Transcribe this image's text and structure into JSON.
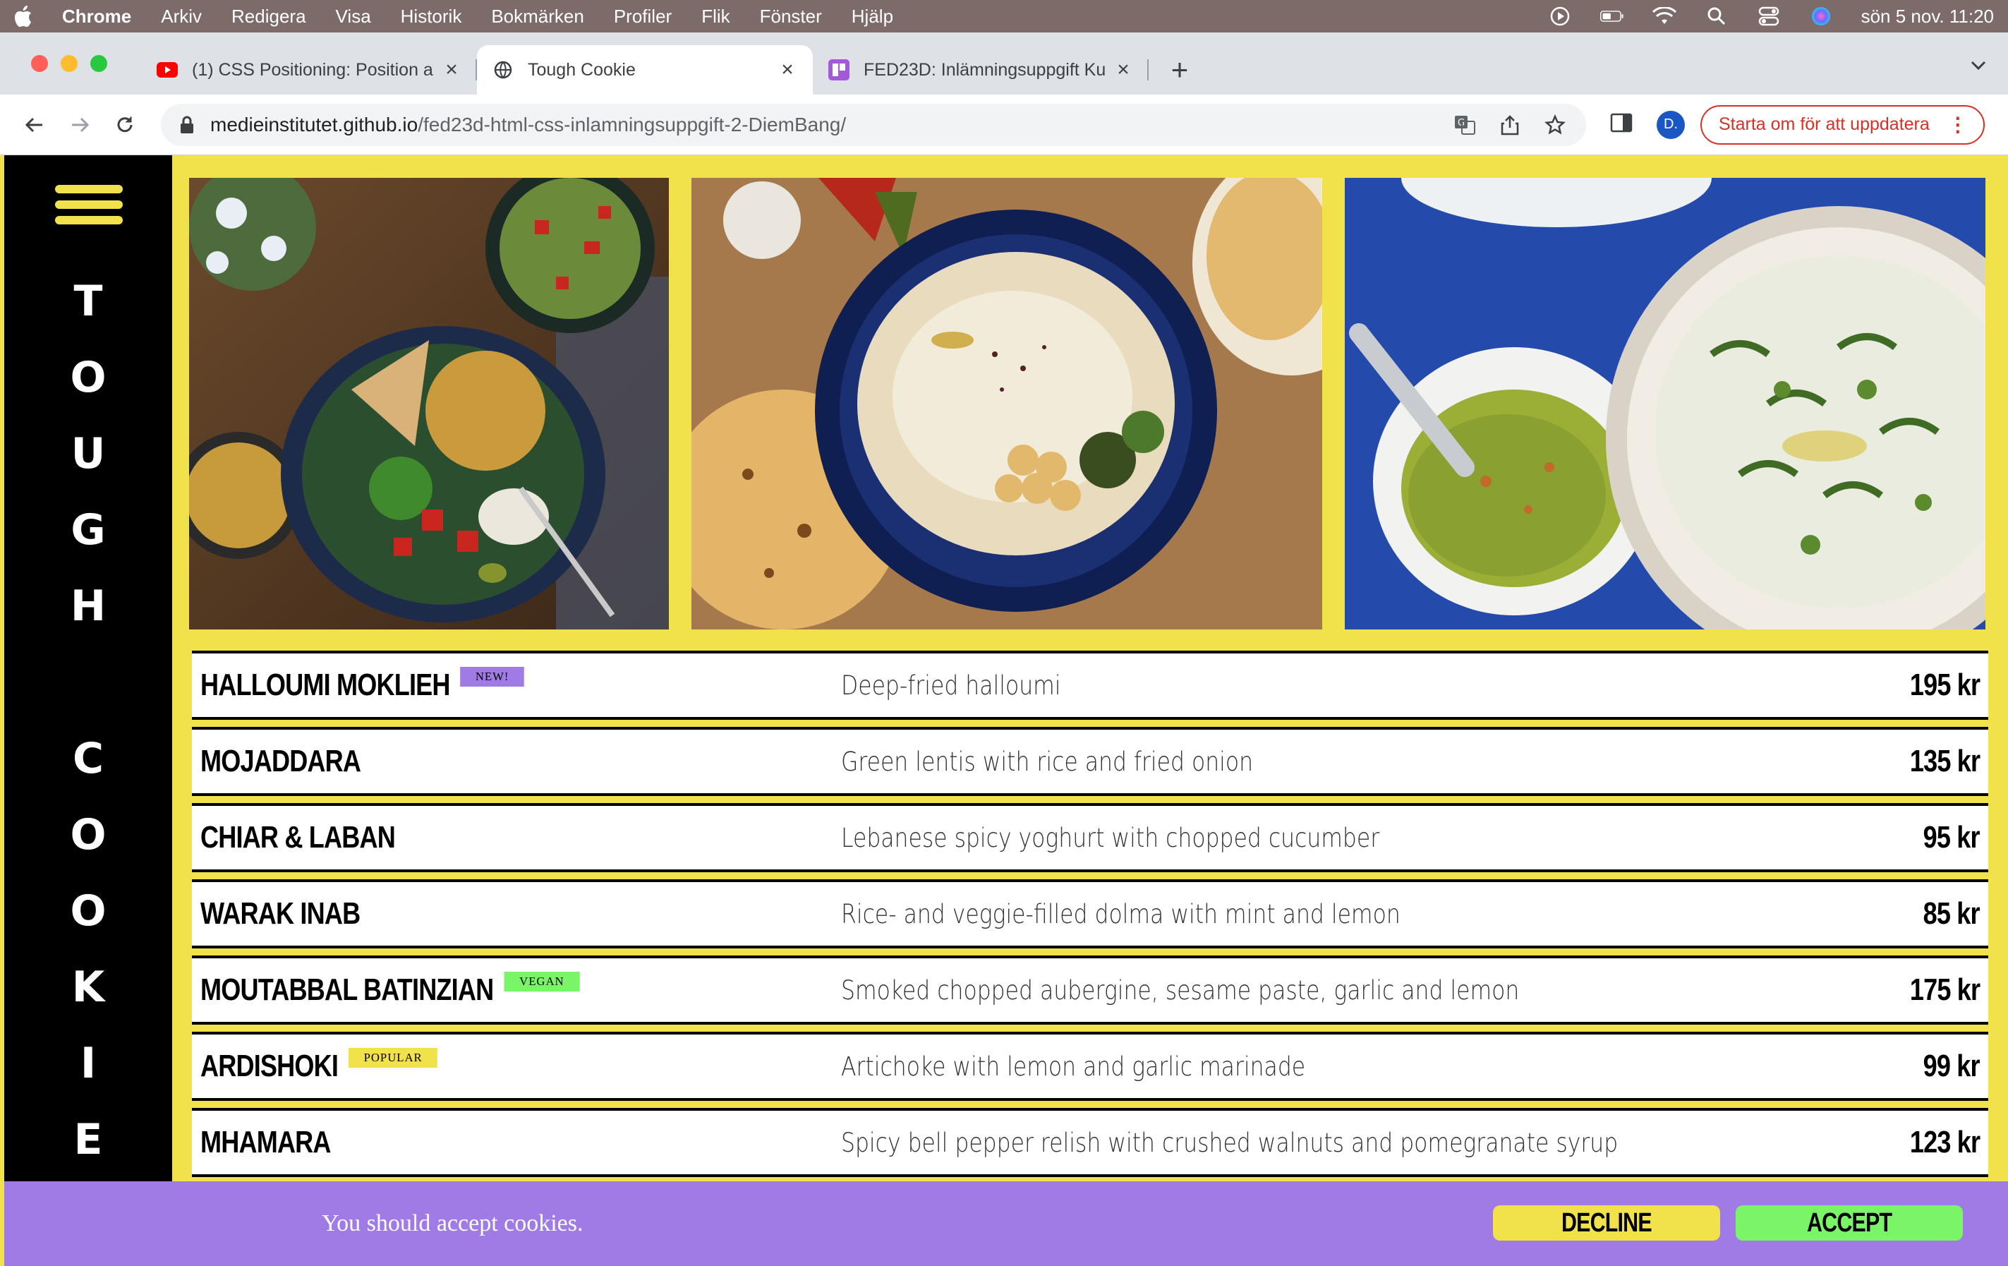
{
  "menubar": {
    "items": [
      "Chrome",
      "Arkiv",
      "Redigera",
      "Visa",
      "Historik",
      "Bokmärken",
      "Profiler",
      "Flik",
      "Fönster",
      "Hjälp"
    ],
    "clock": "sön 5 nov. 11:20"
  },
  "tabs": [
    {
      "title": "(1) CSS Positioning: Position a",
      "icon": "youtube-icon"
    },
    {
      "title": "Tough Cookie",
      "icon": "globe-icon"
    },
    {
      "title": "FED23D: Inlämningsuppgift Ku",
      "icon": "classroom-icon"
    }
  ],
  "address": {
    "host": "medieinstitutet.github.io",
    "path": "/fed23d-html-css-inlamningsuppgift-2-DiemBang/"
  },
  "profile_initial": "D.",
  "update_label": "Starta om för att uppdatera",
  "brand": {
    "word1": [
      "T",
      "O",
      "U",
      "G",
      "H"
    ],
    "word2": [
      "C",
      "O",
      "O",
      "K",
      "I",
      "E"
    ]
  },
  "photos": [
    {
      "alt": "mezze-bowl-photo"
    },
    {
      "alt": "hummus-photo"
    },
    {
      "alt": "yoghurt-dip-photo"
    }
  ],
  "menu": [
    {
      "name": "HALLOUMI MOKLIEH",
      "badge": "NEW!",
      "badge_color": "#a07be6",
      "desc": "Deep-fried halloumi",
      "price": "195 kr"
    },
    {
      "name": "MOJADDARA",
      "badge": "",
      "badge_color": "",
      "desc": "Green lentis with rice and fried onion",
      "price": "135 kr"
    },
    {
      "name": "CHIAR & LABAN",
      "badge": "",
      "badge_color": "",
      "desc": "Lebanese spicy yoghurt with chopped cucumber",
      "price": "95 kr"
    },
    {
      "name": "WARAK INAB",
      "badge": "",
      "badge_color": "",
      "desc": "Rice- and veggie-filled dolma with mint and lemon",
      "price": "85 kr"
    },
    {
      "name": "MOUTABBAL BATINZIAN",
      "badge": "VEGAN",
      "badge_color": "#79f567",
      "desc": "Smoked chopped aubergine, sesame paste, garlic and lemon",
      "price": "175 kr"
    },
    {
      "name": "ARDISHOKI",
      "badge": "POPULAR",
      "badge_color": "#f1e24c",
      "desc": "Artichoke with lemon and garlic marinade",
      "price": "99 kr"
    },
    {
      "name": "MHAMARA",
      "badge": "",
      "badge_color": "",
      "desc": "Spicy bell pepper relish with crushed walnuts and pomegranate syrup",
      "price": "123 kr"
    }
  ],
  "cookie": {
    "message": "You should accept cookies.",
    "decline": "DECLINE",
    "accept": "ACCEPT"
  },
  "colors": {
    "page_bg": "#f1e24c",
    "sidebar_bg": "#000000",
    "cookie_bg": "#a07be6",
    "accept_bg": "#79f567",
    "decline_bg": "#f1e24c"
  }
}
